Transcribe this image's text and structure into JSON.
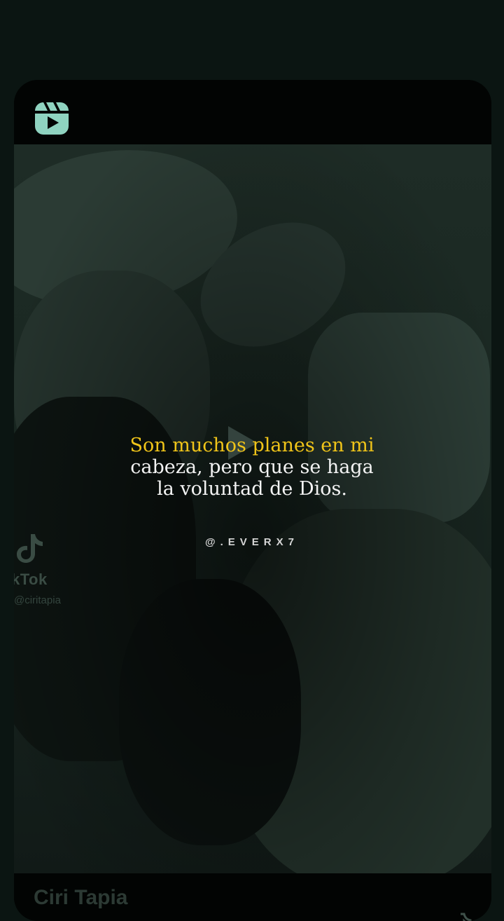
{
  "caption": {
    "highlight": "Son muchos planes en mi",
    "line2": "cabeza, pero que se haga",
    "line3": "la voluntad de Dios."
  },
  "credit": "@.EVERX7",
  "watermark": {
    "brand": "kTok",
    "handle": "@ciritapia"
  },
  "author": {
    "name": "Ciri Tapia"
  },
  "icons": {
    "reels": "reels-icon",
    "play": "play-icon",
    "tiktok": "tiktok-icon",
    "profile": "profile-icon"
  },
  "colors": {
    "background": "#0b1512",
    "highlight": "#f0c419",
    "caption_text": "#f3f3f3"
  }
}
